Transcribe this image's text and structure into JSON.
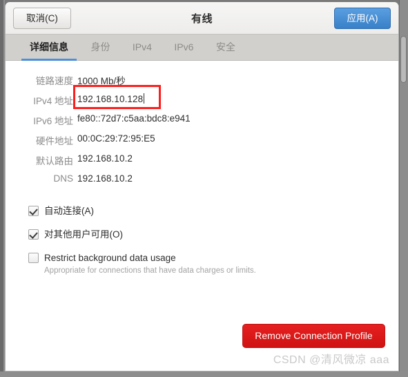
{
  "window": {
    "title": "有线"
  },
  "headerbar": {
    "cancel_label": "取消(C)",
    "apply_label": "应用(A)",
    "apply_color": "#3880c8"
  },
  "tabs": [
    {
      "label": "详细信息",
      "active": true
    },
    {
      "label": "身份",
      "active": false
    },
    {
      "label": "IPv4",
      "active": false
    },
    {
      "label": "IPv6",
      "active": false
    },
    {
      "label": "安全",
      "active": false
    }
  ],
  "details": [
    {
      "label": "链路速度",
      "value": "1000 Mb/秒"
    },
    {
      "label": "IPv4 地址",
      "value": "192.168.10.128",
      "annotated": true
    },
    {
      "label": "IPv6 地址",
      "value": "fe80::72d7:c5aa:bdc8:e941"
    },
    {
      "label": "硬件地址",
      "value": "00:0C:29:72:95:E5"
    },
    {
      "label": "默认路由",
      "value": "192.168.10.2"
    },
    {
      "label": "DNS",
      "value": "192.168.10.2"
    }
  ],
  "checkboxes": [
    {
      "label": "自动连接(A)",
      "checked": true,
      "subtitle": ""
    },
    {
      "label": "对其他用户可用(O)",
      "checked": true,
      "subtitle": ""
    },
    {
      "label": "Restrict background data usage",
      "checked": false,
      "subtitle": "Appropriate for connections that have data charges or limits."
    }
  ],
  "actions": {
    "remove_label": "Remove Connection Profile",
    "remove_color": "#d81717"
  },
  "annotation": {
    "color": "#fc1d1d",
    "target": "IPv4 地址"
  },
  "watermark": {
    "text": "CSDN @清风微凉 aaa"
  }
}
